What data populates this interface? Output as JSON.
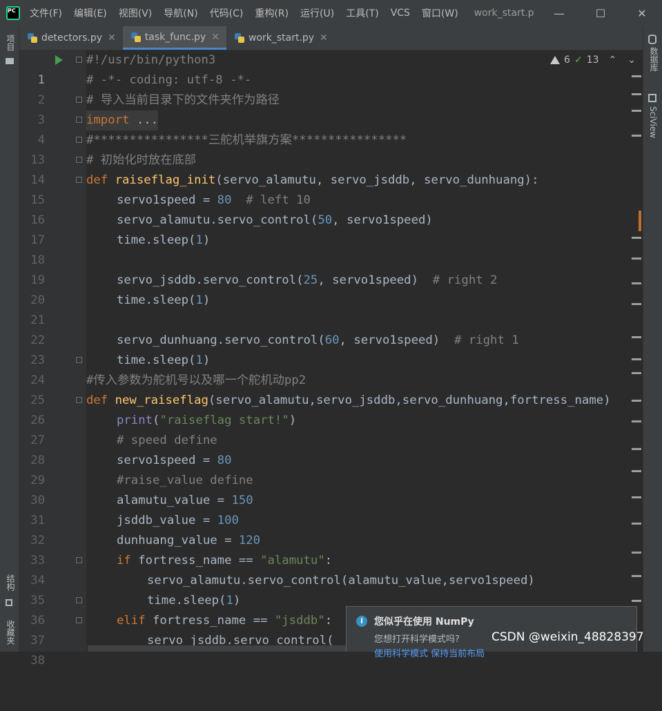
{
  "titlebar": {
    "menu": [
      "文件(F)",
      "编辑(E)",
      "视图(V)",
      "导航(N)",
      "代码(C)",
      "重构(R)",
      "运行(U)",
      "工具(T)",
      "VCS",
      "窗口(W)"
    ],
    "title": "work_start.p"
  },
  "left_tools": {
    "project": "项目",
    "structure": "结构",
    "favorites": "收藏夹"
  },
  "right_tools": {
    "database": "数据库",
    "sciview": "SciView"
  },
  "tabs": [
    {
      "label": "detectors.py"
    },
    {
      "label": "task_func.py"
    },
    {
      "label": "work_start.py"
    }
  ],
  "inspections": {
    "warnings": "6",
    "ok": "13"
  },
  "code": {
    "line_numbers": [
      "1",
      "2",
      "3",
      "4",
      "13",
      "14",
      "15",
      "16",
      "17",
      "18",
      "19",
      "20",
      "21",
      "22",
      "23",
      "24",
      "25",
      "26",
      "27",
      "28",
      "29",
      "30",
      "31",
      "32",
      "33",
      "34",
      "35",
      "36",
      "37",
      "38"
    ],
    "l1": "#!/usr/bin/python3",
    "l2": "# -*- coding: utf-8 -*-",
    "l3": "# 导入当前目录下的文件夹作为路径",
    "l4_kw": "import",
    "l4_rest": " ...",
    "l13": "#****************三舵机举旗方案****************",
    "l14": "# 初始化时放在底部",
    "l15_def": "def",
    "l15_fn": "raiseflag_init",
    "l15_args": "(servo_alamutu, servo_jsddb, servo_dunhuang):",
    "l16_a": "servo1speed = ",
    "l16_n": "80",
    "l16_c": "  # left 10",
    "l17_a": "servo_alamutu.servo_control(",
    "l17_n": "50",
    "l17_b": ", servo1speed)",
    "l18_a": "time.sleep(",
    "l18_n": "1",
    "l18_b": ")",
    "l20_a": "servo_jsddb.servo_control(",
    "l20_n": "25",
    "l20_b": ", servo1speed)",
    "l20_c": "  # right 2",
    "l21_a": "time.sleep(",
    "l21_n": "1",
    "l21_b": ")",
    "l23_a": "servo_dunhuang.servo_control(",
    "l23_n": "60",
    "l23_b": ", servo1speed)",
    "l23_c": "  # right 1",
    "l24_a": "time.sleep(",
    "l24_n": "1",
    "l24_b": ")",
    "l25": "#传入参数为舵机号以及哪一个舵机动pp2",
    "l26_def": "def",
    "l26_fn": "new_raiseflag",
    "l26_args": "(servo_alamutu,servo_jsddb,servo_dunhuang,fortress_name)",
    "l27_bi": "print",
    "l27_a": "(",
    "l27_s": "\"raiseflag start!\"",
    "l27_b": ")",
    "l28": "# speed define",
    "l29_a": "servo1speed = ",
    "l29_n": "80",
    "l30": "#raise_value define",
    "l31_a": "alamutu_value = ",
    "l31_n": "150",
    "l32_a": "jsddb_value = ",
    "l32_n": "100",
    "l33_a": "dunhuang_value = ",
    "l33_n": "120",
    "l34_kw": "if",
    "l34_a": " fortress_name == ",
    "l34_s": "\"alamutu\"",
    "l34_b": ":",
    "l35": "servo_alamutu.servo_control(alamutu_value,servo1speed)",
    "l36_a": "time.sleep(",
    "l36_n": "1",
    "l36_b": ")",
    "l37_kw": "elif",
    "l37_a": " fortress_name == ",
    "l37_s": "\"jsddb\"",
    "l37_b": ":",
    "l38": "servo_jsddb.servo_control("
  },
  "notification": {
    "title": "您似乎在使用 NumPy",
    "body": "您想打开科学模式吗?",
    "links": "使用科学模式   保持当前布局"
  },
  "watermark": "CSDN @weixin_48828397",
  "colors": {
    "keyword": "#cc7832",
    "function": "#ffc66d",
    "number": "#6897bb",
    "string": "#6a8759",
    "comment": "#808080",
    "accent": "#4a88c7"
  }
}
